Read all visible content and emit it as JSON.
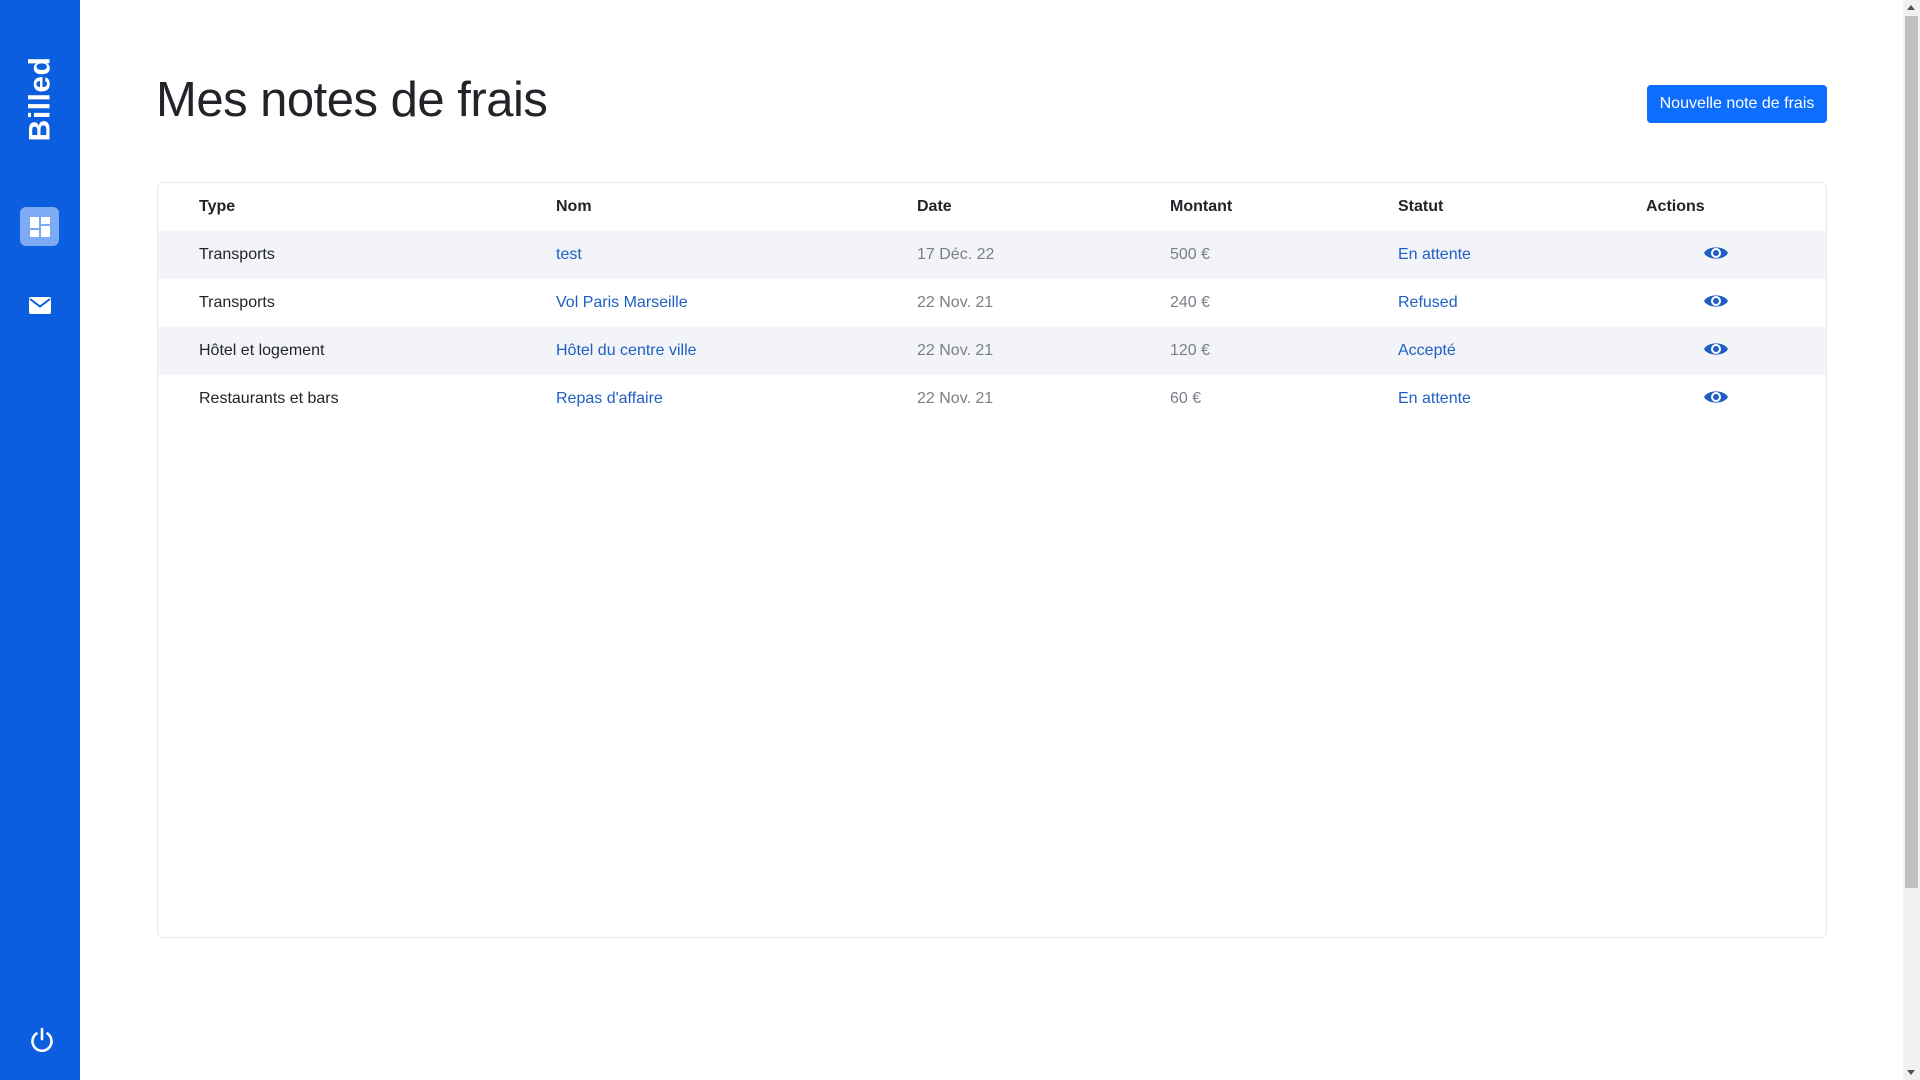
{
  "sidebar": {
    "brand": "Billed",
    "items": [
      {
        "name": "dashboard",
        "icon": "dashboard-icon",
        "active": true
      },
      {
        "name": "mail",
        "icon": "mail-icon",
        "active": false
      }
    ],
    "logout_icon": "power-icon"
  },
  "header": {
    "title": "Mes notes de frais",
    "new_bill_label": "Nouvelle note de frais"
  },
  "table": {
    "columns": [
      "Type",
      "Nom",
      "Date",
      "Montant",
      "Statut",
      "Actions"
    ],
    "rows": [
      {
        "type": "Transports",
        "name": "test",
        "date": "17 Déc. 22",
        "amount": "500 €",
        "status": "En attente"
      },
      {
        "type": "Transports",
        "name": "Vol Paris Marseille",
        "date": "22 Nov. 21",
        "amount": "240 €",
        "status": "Refused"
      },
      {
        "type": "Hôtel et logement",
        "name": "Hôtel du centre ville",
        "date": "22 Nov. 21",
        "amount": "120 €",
        "status": "Accepté"
      },
      {
        "type": "Restaurants et bars",
        "name": "Repas d'affaire",
        "date": "22 Nov. 21",
        "amount": "60 €",
        "status": "En attente"
      }
    ],
    "action_icon": "eye-icon"
  },
  "colors": {
    "sidebar": "#0b5ee0",
    "accent": "#0d6efd",
    "link": "#1f5fc4",
    "muted": "#7a7f87",
    "row_stripe": "#f3f4f8"
  }
}
